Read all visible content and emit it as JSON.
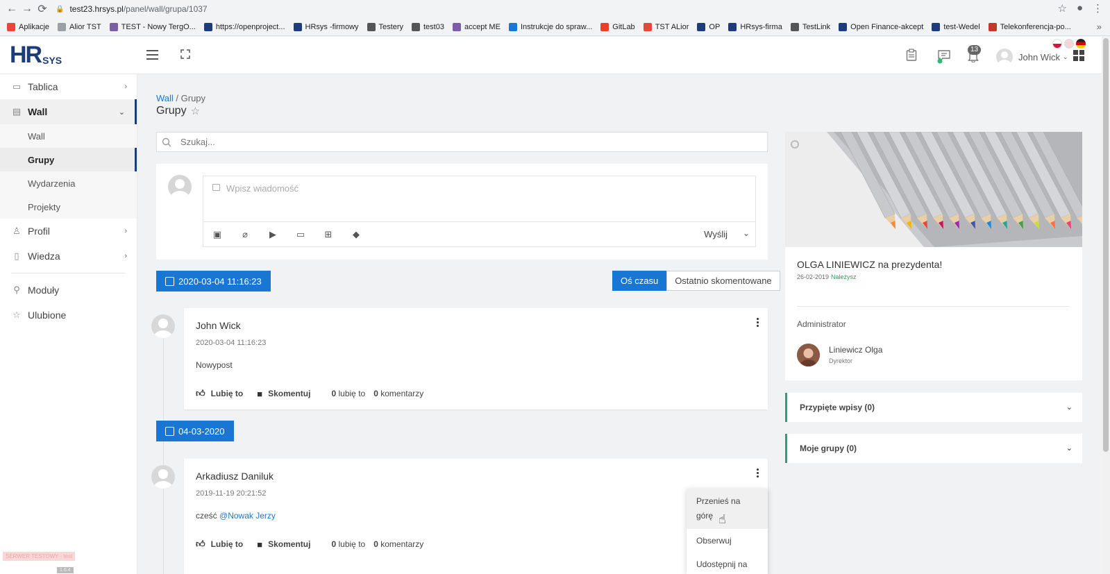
{
  "browser": {
    "url_host": "test23.hrsys.pl",
    "url_path": "/panel/wall/grupa/1037",
    "bookmarks": [
      {
        "label": "Aplikacje",
        "icon": "apps-grid-icon",
        "color": "#e8453c"
      },
      {
        "label": "Alior TST",
        "icon": "page-icon",
        "color": "#9aa0a6"
      },
      {
        "label": "TEST - Nowy TergO...",
        "icon": "logo-icon",
        "color": "#7b5ea7"
      },
      {
        "label": "https://openproject...",
        "icon": "hr-icon",
        "color": "#1d3d7a"
      },
      {
        "label": "HRsys -firmowy",
        "icon": "bars-icon",
        "color": "#1d3d7a"
      },
      {
        "label": "Testery",
        "icon": "flask-icon",
        "color": "#555555"
      },
      {
        "label": "test03",
        "icon": "flask-icon",
        "color": "#555555"
      },
      {
        "label": "accept ME",
        "icon": "logo-icon",
        "color": "#7b5ea7"
      },
      {
        "label": "Instrukcje do spraw...",
        "icon": "conf-icon",
        "color": "#1976d2"
      },
      {
        "label": "GitLab",
        "icon": "gitlab-icon",
        "color": "#e24329"
      },
      {
        "label": "TST ALior",
        "icon": "star-badge-icon",
        "color": "#e8453c"
      },
      {
        "label": "OP",
        "icon": "hr-icon",
        "color": "#1d3d7a"
      },
      {
        "label": "HRsys-firma",
        "icon": "bars-icon",
        "color": "#1d3d7a"
      },
      {
        "label": "TestLink",
        "icon": "globe-icon",
        "color": "#555555"
      },
      {
        "label": "Open Finance-akcept",
        "icon": "bars-icon",
        "color": "#1d3d7a"
      },
      {
        "label": "test-Wedel",
        "icon": "circle-logo-icon",
        "color": "#1d3d7a"
      },
      {
        "label": "Telekonferencja-po...",
        "icon": "w-icon",
        "color": "#c0392b"
      }
    ]
  },
  "header": {
    "logo_h": "HR",
    "logo_sys": "SYS",
    "notifications_count": "13",
    "user_name": "John Wick"
  },
  "sidebar": {
    "items": [
      {
        "label": "Tablica",
        "icon": "monitor-icon"
      },
      {
        "label": "Wall",
        "icon": "wall-icon"
      },
      {
        "label": "Profil",
        "icon": "user-icon"
      },
      {
        "label": "Wiedza",
        "icon": "book-icon"
      },
      {
        "label": "Moduły",
        "icon": "wrench-icon"
      },
      {
        "label": "Ulubione",
        "icon": "star-icon"
      }
    ],
    "sub": [
      "Wall",
      "Grupy",
      "Wydarzenia",
      "Projekty"
    ],
    "server_label": "SERWER TESTOWY - test",
    "version_label": "1.6.4"
  },
  "page": {
    "breadcrumb_link": "Wall",
    "breadcrumb_current": "Grupy",
    "title": "Grupy"
  },
  "search": {
    "placeholder": "Szukaj..."
  },
  "composer": {
    "placeholder": "Wpisz wiadomość",
    "send_label": "Wyślij"
  },
  "timeline": {
    "date_1": "2020-03-04 11:16:23",
    "date_2": "04-03-2020",
    "sort_options": [
      "Oś czasu",
      "Ostatnio skomentowane"
    ]
  },
  "posts": [
    {
      "author": "John Wick",
      "time": "2020-03-04 11:16:23",
      "text": "Nowypost",
      "like_label": "Lubię to",
      "comment_label": "Skomentuj",
      "likes": "0",
      "likes_label": "lubię to",
      "comments": "0",
      "comments_label": "komentarzy"
    },
    {
      "author": "Arkadiusz Daniluk",
      "time": "2019-11-19 20:21:52",
      "text_prefix": "cześć ",
      "mention": "@Nowak Jerzy",
      "like_label": "Lubię to",
      "comment_label": "Skomentuj",
      "likes": "0",
      "likes_label": "lubię to",
      "comments": "0",
      "comments_label": "komentarzy"
    }
  ],
  "post_menu": {
    "items": [
      "Przenieś na górę",
      "Obserwuj",
      "Udostępnij na"
    ]
  },
  "group": {
    "title": "OLGA LINIEWICZ na prezydenta!",
    "date": "26-02-2019",
    "member_label": "Należysz",
    "admin_label": "Administrator",
    "admin_name": "Liniewicz Olga",
    "admin_role": "Dyrektor"
  },
  "accordions": [
    {
      "label": "Przypięte wpisy (0)"
    },
    {
      "label": "Moje grupy (0)"
    }
  ],
  "colors": {
    "accent": "#1976d2",
    "brand": "#1d3d7a",
    "green": "#2e9e75"
  }
}
